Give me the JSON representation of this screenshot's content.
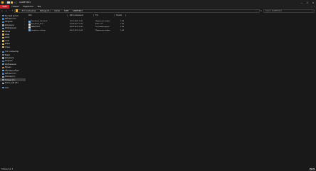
{
  "window": {
    "title": "SAMPFUNC1",
    "controls": [
      "—",
      "☐",
      "✕"
    ]
  },
  "ribbon": {
    "tabs": [
      "Файл",
      "Главная",
      "Поделиться",
      "Вид"
    ]
  },
  "address": {
    "crumbs": [
      "Этот компьютер",
      "Notsage (D:)",
      "Games",
      "SAMP",
      "SAMPFUNC1"
    ]
  },
  "search": {
    "placeholder": "Поиск: SAMPFUNC1"
  },
  "nav": {
    "items": [
      {
        "label": "Быстрый доступ",
        "color": "#4a90d9"
      },
      {
        "label": "Рабочий стол",
        "color": "#2f7fd6",
        "pinned": true
      },
      {
        "label": "Загрузки",
        "color": "#3c8be0",
        "pinned": true
      },
      {
        "label": "Документы",
        "color": "#9aa4b2",
        "pinned": true
      },
      {
        "label": "Изображения",
        "color": "#4fa3e0",
        "pinned": true
      },
      {
        "label": "Лалка",
        "color": "#e8b64a"
      },
      {
        "label": "моды",
        "color": "#e8b64a"
      },
      {
        "label": "ммом",
        "color": "#e8b64a"
      },
      {
        "label": "mods",
        "color": "#e8b64a"
      },
      {
        "label": "Видео",
        "color": "#e8b64a"
      },
      {
        "label": "Стоки",
        "color": "#e8b64a"
      },
      {
        "label": "Этот компьютер",
        "color": "#4a90d9"
      },
      {
        "label": "Видео",
        "color": "#6e7fa8"
      },
      {
        "label": "Документы",
        "color": "#9aa4b2"
      },
      {
        "label": "Загрузки",
        "color": "#3c8be0"
      },
      {
        "label": "Изображения",
        "color": "#4fa3e0"
      },
      {
        "label": "Музыка",
        "color": "#e07a3c"
      },
      {
        "label": "Объемные объек",
        "color": "#5fb0e8"
      },
      {
        "label": "Рабочий стол",
        "color": "#2f7fd6"
      },
      {
        "label": "Windows (C:)",
        "color": "#8fa3bd"
      },
      {
        "label": "Notsage (D:)",
        "color": "#8fa3bd"
      },
      {
        "label": "Promo_X_P2 (Xf:)",
        "color": "#8fa3bd"
      },
      {
        "label": "Сеть",
        "color": "#4a90d9"
      }
    ]
  },
  "columns": {
    "name": "Имя",
    "date": "Дата изменения",
    "type": "Тип",
    "size": "Размер"
  },
  "files": [
    {
      "name": "Roundstart_SanFran.lf",
      "date": "28.11.2020 13:30",
      "type": "Параметры конфи...",
      "size": "1 КБ",
      "color": "#7aa7d9"
    },
    {
      "name": "Roundstart_SF.cf",
      "date": "03.04.2021 11:00",
      "type": "Файл \"CF\"",
      "size": "1 КБ",
      "color": "#e8e8e8"
    },
    {
      "name": "SAMPFUNC1",
      "date": "08.01.2022 20:33",
      "type": "Текстовый докум...",
      "size": "1 КБ",
      "color": "#e8e8e8"
    },
    {
      "name": "sampfuncs-settings",
      "date": "08.01.2022 20:24",
      "type": "Параметры конфи...",
      "size": "1 КБ",
      "color": "#7aa7d9"
    }
  ],
  "status": {
    "text": "Элементов: 4"
  }
}
